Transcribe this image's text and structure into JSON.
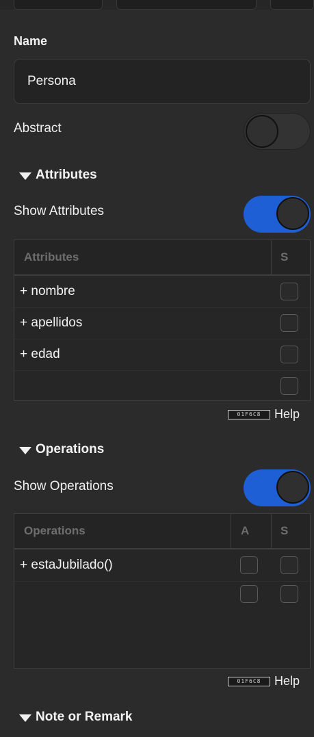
{
  "name_section": {
    "label": "Name",
    "value": "Persona"
  },
  "abstract": {
    "label": "Abstract",
    "enabled": false
  },
  "attributes": {
    "section_title": "Attributes",
    "show_label": "Show Attributes",
    "show_enabled": true,
    "columns": [
      "Attributes",
      "S"
    ],
    "rows": [
      "+ nombre",
      "+ apellidos",
      "+ edad",
      ""
    ],
    "help_badge": "01F6C8",
    "help_label": "Help"
  },
  "operations": {
    "section_title": "Operations",
    "show_label": "Show Operations",
    "show_enabled": true,
    "columns": [
      "Operations",
      "A",
      "S"
    ],
    "rows": [
      "+ estaJubilado()",
      ""
    ],
    "help_badge": "01F6C8",
    "help_label": "Help"
  },
  "note": {
    "section_title": "Note or Remark"
  },
  "colors": {
    "toggle_on": "#1f5fd6",
    "background": "#2b2b2b"
  }
}
